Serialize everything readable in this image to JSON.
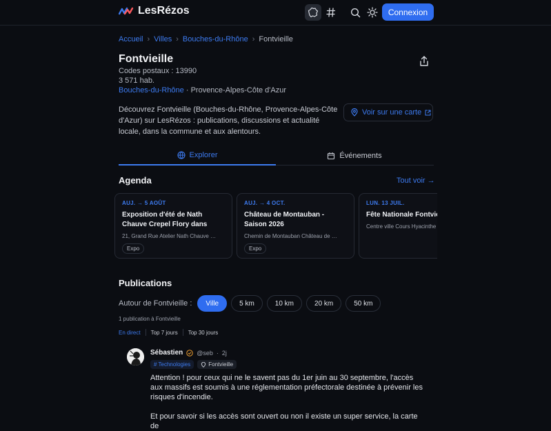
{
  "header": {
    "logo_text": "LesRézos",
    "connexion_label": "Connexion",
    "icons": [
      "map-france-icon",
      "hashtag-icon",
      "search-icon",
      "sun-icon"
    ]
  },
  "breadcrumb": {
    "items": [
      "Accueil",
      "Villes",
      "Bouches-du-Rhône"
    ],
    "current": "Fontvieille"
  },
  "city": {
    "name": "Fontvieille",
    "postal": "Codes postaux : 13990",
    "population": "3 571 hab.",
    "department": "Bouches-du-Rhône",
    "region": " · Provence-Alpes-Côte d'Azur",
    "description": "Découvrez Fontvieille (Bouches-du-Rhône, Provence-Alpes-Côte d'Azur) sur LesRézos : publications, discussions et actualité locale, dans la commune et aux alentours.",
    "map_button": "Voir sur une carte"
  },
  "tabs": {
    "explorer": "Explorer",
    "events": "Événements"
  },
  "agenda": {
    "title": "Agenda",
    "see_all": "Tout voir →",
    "cards": [
      {
        "date": "AUJ. → 5 AOÛT",
        "title": "Exposition d'été de Nath Chauve Crepel Flory dans son…",
        "location": "21, Grand Rue Atelier Nath Chauve …",
        "tag": "Expo"
      },
      {
        "date": "AUJ. → 4 OCT.",
        "title": "Château de Montauban - Saison 2026",
        "location": "Chemin de Montauban Château de …",
        "tag": "Expo"
      },
      {
        "date": "LUN. 13 JUIL.",
        "title": "Fête Nationale Fontvieille",
        "location": "Centre ville Cours Hyacinthe",
        "tag": ""
      }
    ]
  },
  "publications": {
    "title": "Publications",
    "filter_label": "Autour de Fontvieille :",
    "chips": [
      "Ville",
      "5 km",
      "10 km",
      "20 km",
      "50 km"
    ],
    "count": "1 publication à Fontvieille",
    "sorts": [
      "En direct",
      "Top 7 jours",
      "Top 30 jours"
    ]
  },
  "post": {
    "author": "Sébastien",
    "handle": "@seb",
    "dot": "·",
    "age": "2j",
    "tag_topic": "# Technologies",
    "tag_place": "Fontvieille",
    "text_1": "Attention ! pour ceux qui ne le savent pas du 1er juin au 30 septembre, l'accès aux massifs est soumis à une réglementation préfectorale destinée à prévenir les risques d'incendie.",
    "text_2": "Et pour savoir si les accès sont ouvert ou non il existe un super service, la carte de"
  },
  "colors": {
    "accent": "#2f6df0",
    "background": "#0b0d12",
    "link": "#3d7bf0"
  }
}
